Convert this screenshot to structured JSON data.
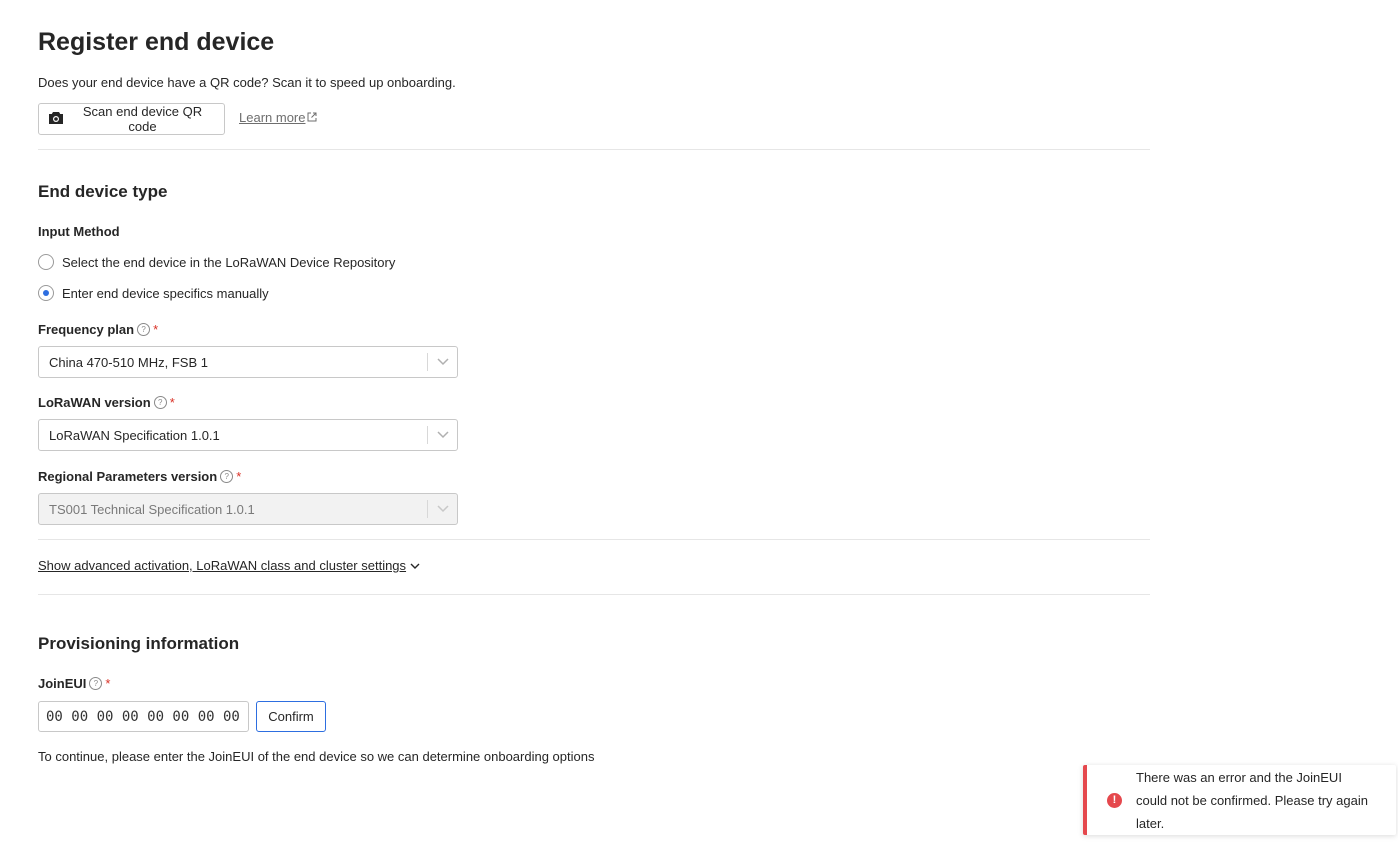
{
  "header": {
    "title": "Register end device",
    "qr_description": "Does your end device have a QR code? Scan it to speed up onboarding.",
    "scan_button_label": "Scan end device QR code",
    "learn_more_label": "Learn more"
  },
  "end_device_type": {
    "title": "End device type",
    "input_method_label": "Input Method",
    "radio_options": [
      {
        "label": "Select the end device in the LoRaWAN Device Repository",
        "checked": false
      },
      {
        "label": "Enter end device specifics manually",
        "checked": true
      }
    ],
    "frequency_plan": {
      "label": "Frequency plan",
      "value": "China 470-510 MHz, FSB 1"
    },
    "lorawan_version": {
      "label": "LoRaWAN version",
      "value": "LoRaWAN Specification 1.0.1"
    },
    "regional_parameters": {
      "label": "Regional Parameters version",
      "value": "TS001 Technical Specification 1.0.1",
      "disabled": true
    },
    "required_marker": "*",
    "help_glyph": "?"
  },
  "advanced_link_label": "Show advanced activation, LoRaWAN class and cluster settings",
  "provisioning": {
    "title": "Provisioning information",
    "join_eui_label": "JoinEUI",
    "join_eui_value": "00 00 00 00 00 00 00 00",
    "confirm_label": "Confirm",
    "hint": "To continue, please enter the JoinEUI of the end device so we can determine onboarding options"
  },
  "toast": {
    "icon_glyph": "!",
    "message": "There was an error and the JoinEUI could not be confirmed. Please try again later."
  },
  "colors": {
    "accent": "#2d6ee0",
    "error": "#e5484d",
    "required": "#d93025"
  },
  "icons": {
    "camera": "camera-icon",
    "external_link": "external-link-icon",
    "chevron": "chevron-down-icon",
    "help": "help-icon",
    "error": "error-icon"
  }
}
